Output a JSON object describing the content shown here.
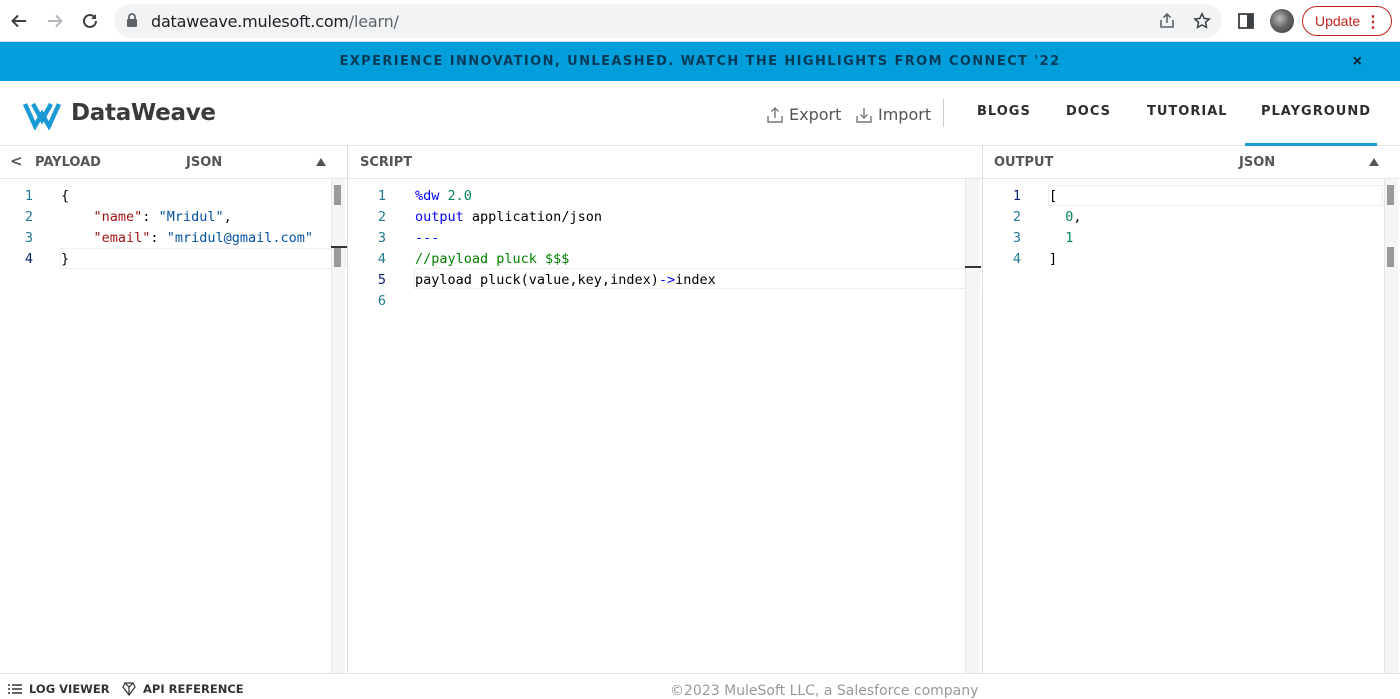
{
  "browser": {
    "url_host": "dataweave.mulesoft.com",
    "url_path": "/learn/",
    "update_label": "Update"
  },
  "banner": {
    "text": "EXPERIENCE INNOVATION, UNLEASHED. WATCH THE HIGHLIGHTS FROM CONNECT '22",
    "close": "×"
  },
  "header": {
    "brand": "DataWeave",
    "export_label": "Export",
    "import_label": "Import",
    "nav": [
      "BLOGS",
      "DOCS",
      "TUTORIAL",
      "PLAYGROUND"
    ],
    "active_nav": "PLAYGROUND",
    "accent_color": "#1b9ad6"
  },
  "payload": {
    "back": "<",
    "title": "PAYLOAD",
    "format": "JSON",
    "line_numbers": [
      "1",
      "2",
      "3",
      "4"
    ],
    "lines": {
      "l1": "{",
      "l2_key": "\"name\"",
      "l2_colon": ": ",
      "l2_val": "\"Mridul\"",
      "l2_end": ",",
      "l3_key": "\"email\"",
      "l3_colon": ": ",
      "l3_val": "\"mridul@gmail.com\"",
      "l4": "}"
    }
  },
  "script": {
    "title": "SCRIPT",
    "line_numbers": [
      "1",
      "2",
      "3",
      "4",
      "5",
      "6"
    ],
    "current_line": "5",
    "lines": {
      "l1_kw": "%dw",
      "l1_num": " 2.0",
      "l2_kw": "output",
      "l2_rest": " application/json",
      "l3": "---",
      "l4": "//payload pluck $$$",
      "l5_a": "payload pluck(value,key,index)",
      "l5_op": "->",
      "l5_b": "index"
    }
  },
  "output": {
    "title": "OUTPUT",
    "format": "JSON",
    "line_numbers": [
      "1",
      "2",
      "3",
      "4"
    ],
    "lines": {
      "l1": "[",
      "l2_num": "0",
      "l2_end": ",",
      "l3_num": "1",
      "l4": "]"
    }
  },
  "footer": {
    "log_viewer": "LOG VIEWER",
    "api_reference": "API REFERENCE",
    "copyright": "©2023 MuleSoft LLC, a Salesforce company"
  }
}
